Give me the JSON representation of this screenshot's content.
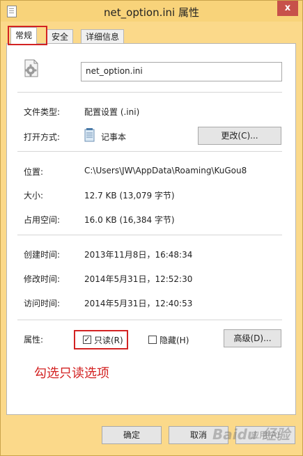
{
  "window": {
    "title": "net_option.ini 属性",
    "close_glyph": "x"
  },
  "tabs": [
    {
      "label": "常规"
    },
    {
      "label": "安全"
    },
    {
      "label": "详细信息"
    }
  ],
  "general": {
    "file_name": "net_option.ini",
    "file_type_label": "文件类型:",
    "file_type_value": "配置设置 (.ini)",
    "open_with_label": "打开方式:",
    "open_with_value": "记事本",
    "change_button": "更改(C)...",
    "location_label": "位置:",
    "location_value": "C:\\Users\\JW\\AppData\\Roaming\\KuGou8",
    "size_label": "大小:",
    "size_value": "12.7 KB (13,079 字节)",
    "disk_size_label": "占用空间:",
    "disk_size_value": "16.0 KB (16,384 字节)",
    "created_label": "创建时间:",
    "created_value": "2013年11月8日，16:48:34",
    "modified_label": "修改时间:",
    "modified_value": "2014年5月31日，12:52:30",
    "accessed_label": "访问时间:",
    "accessed_value": "2014年5月31日，12:40:53",
    "attributes_label": "属性:",
    "readonly_label": "只读(R)",
    "readonly_checked": true,
    "hidden_label": "隐藏(H)",
    "hidden_checked": false,
    "advanced_button": "高级(D)..."
  },
  "annotation": "勾选只读选项",
  "footer": {
    "ok_button": "确定",
    "cancel_button": "取消",
    "apply_button": "应用(A)"
  },
  "watermark": "Baidu 经验",
  "colors": {
    "frame": "#fbd98a",
    "close": "#c7514a",
    "highlight": "#d32222"
  }
}
